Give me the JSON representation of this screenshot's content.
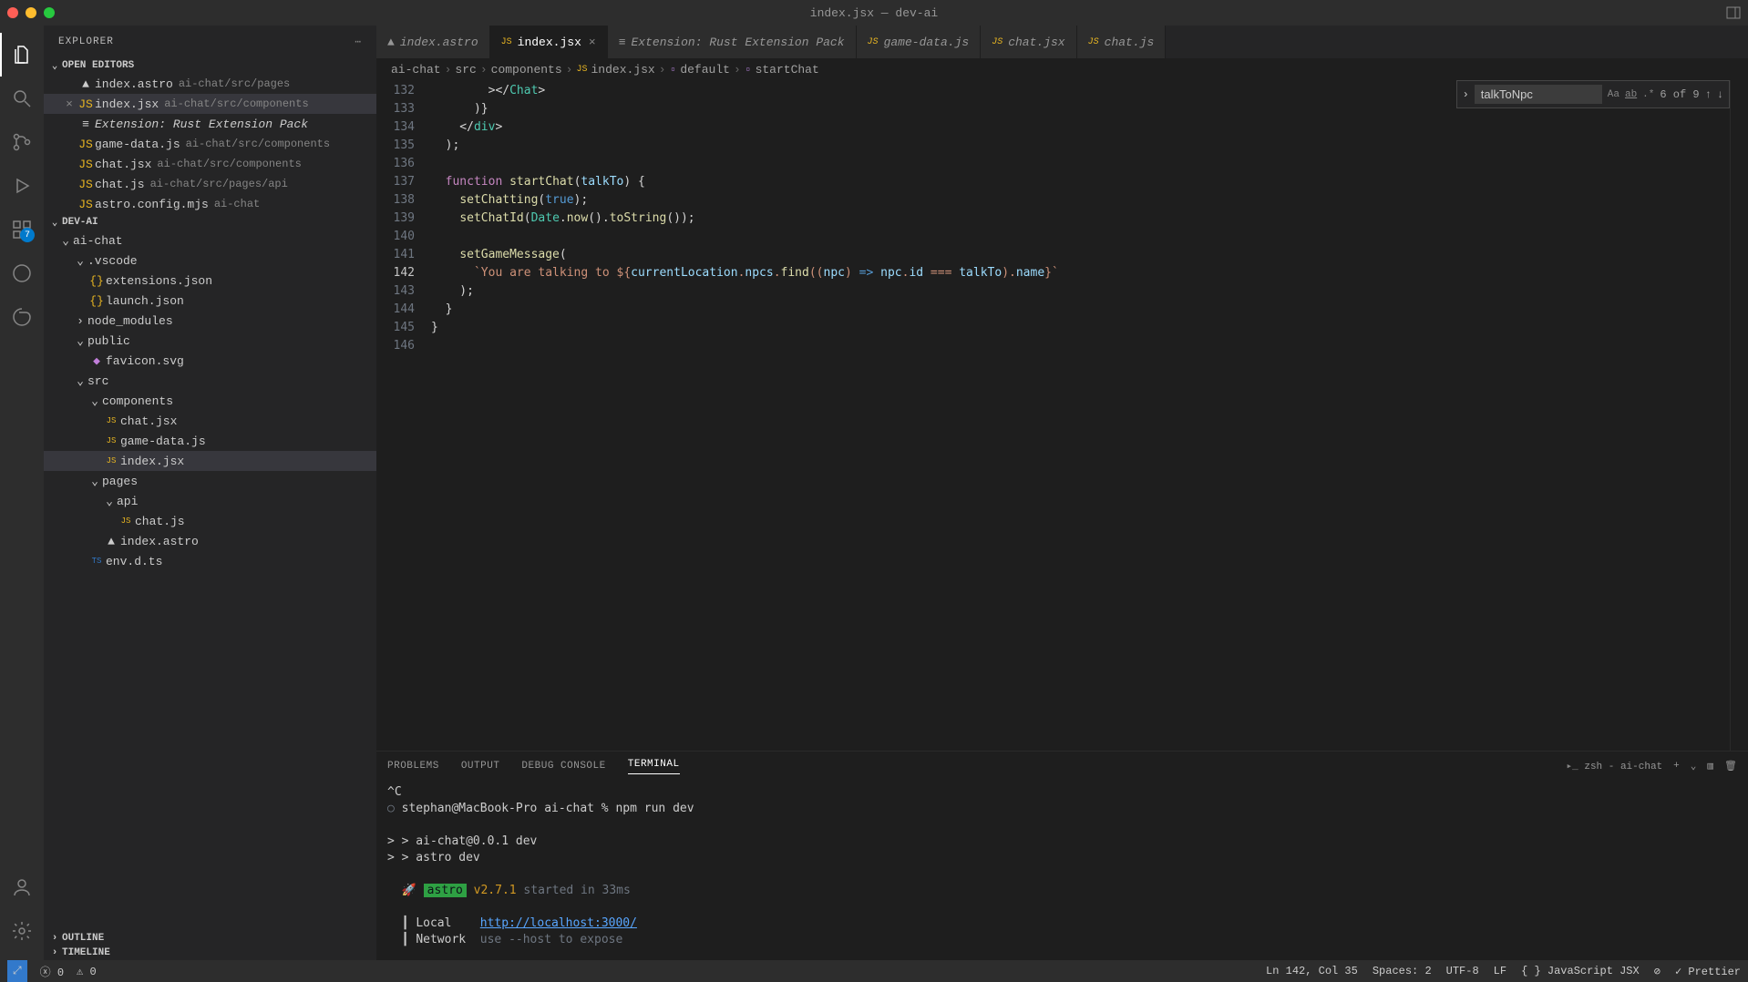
{
  "window": {
    "title": "index.jsx — dev-ai"
  },
  "activity_badge": "7",
  "explorer": {
    "title": "EXPLORER",
    "open_editors_label": "OPEN EDITORS",
    "open_editors": [
      {
        "name": "index.astro",
        "path": "ai-chat/src/pages"
      },
      {
        "name": "index.jsx",
        "path": "ai-chat/src/components"
      },
      {
        "name": "Extension: Rust Extension Pack",
        "path": ""
      },
      {
        "name": "game-data.js",
        "path": "ai-chat/src/components"
      },
      {
        "name": "chat.jsx",
        "path": "ai-chat/src/components"
      },
      {
        "name": "chat.js",
        "path": "ai-chat/src/pages/api"
      },
      {
        "name": "astro.config.mjs",
        "path": "ai-chat"
      }
    ],
    "project_label": "DEV-AI",
    "tree": {
      "ai_chat": "ai-chat",
      "vscode": ".vscode",
      "extensions_json": "extensions.json",
      "launch_json": "launch.json",
      "node_modules": "node_modules",
      "public": "public",
      "favicon": "favicon.svg",
      "src": "src",
      "components": "components",
      "chat_jsx": "chat.jsx",
      "game_data_js": "game-data.js",
      "index_jsx": "index.jsx",
      "pages": "pages",
      "api": "api",
      "chat_js": "chat.js",
      "index_astro": "index.astro",
      "env_dts": "env.d.ts"
    },
    "outline_label": "OUTLINE",
    "timeline_label": "TIMELINE"
  },
  "tabs": [
    {
      "label": "index.astro"
    },
    {
      "label": "index.jsx"
    },
    {
      "label": "Extension: Rust Extension Pack"
    },
    {
      "label": "game-data.js"
    },
    {
      "label": "chat.jsx"
    },
    {
      "label": "chat.js"
    }
  ],
  "breadcrumbs": {
    "p0": "ai-chat",
    "p1": "src",
    "p2": "components",
    "p3": "index.jsx",
    "p4": "default",
    "p5": "startChat"
  },
  "find": {
    "query": "talkToNpc",
    "count": "6 of 9"
  },
  "code": {
    "first_line": 132,
    "lines": [
      "        ></Chat>",
      "      )}",
      "    </div>",
      "  );",
      "",
      "  function startChat(talkTo) {",
      "    setChatting(true);",
      "    setChatId(Date.now().toString());",
      "",
      "    setGameMessage(",
      "      `You are talking to ${currentLocation.npcs.find((npc) => npc.id === talkTo).name}`",
      "    );",
      "  }",
      "}",
      ""
    ],
    "current_line_index": 10
  },
  "panel": {
    "problems": "PROBLEMS",
    "output": "OUTPUT",
    "debug": "DEBUG CONSOLE",
    "terminal": "TERMINAL",
    "shell": "zsh - ai-chat"
  },
  "terminal": {
    "l0": "^C",
    "l1": "stephan@MacBook-Pro ai-chat % npm run dev",
    "l2": "",
    "l3": "> ai-chat@0.0.1 dev",
    "l4": "> astro dev",
    "l5": "",
    "astro_badge": "astro",
    "astro_ver": "v2.7.1",
    "astro_msg": " started in 33ms",
    "local_label": "Local",
    "local_url": "http://localhost:3000/",
    "net_label": "Network",
    "net_msg": "use --host to expose"
  },
  "status": {
    "errors": "0",
    "warnings": "0",
    "pos": "Ln 142, Col 35",
    "spaces": "Spaces: 2",
    "encoding": "UTF-8",
    "eol": "LF",
    "lang": "JavaScript JSX",
    "prettier": "Prettier"
  }
}
